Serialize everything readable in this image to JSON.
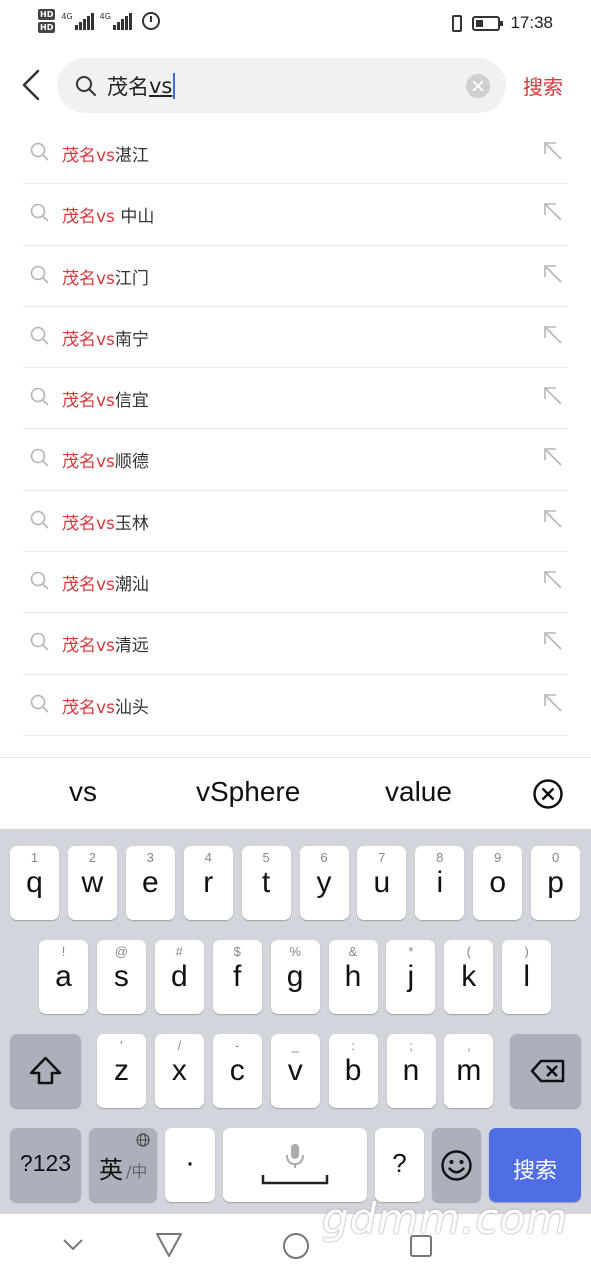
{
  "status_bar": {
    "sim1_label": "HD",
    "sim2_label": "HD",
    "net1_label": "4G",
    "net2_label": "4G",
    "time": "17:38",
    "battery_level": 0.35
  },
  "search": {
    "query_highlight": "茂名",
    "query_rest": "vs",
    "submit_label": "搜索"
  },
  "suggestions": [
    {
      "highlight": "茂名vs",
      "rest": "湛江"
    },
    {
      "highlight": "茂名vs",
      "rest": " 中山"
    },
    {
      "highlight": "茂名vs",
      "rest": "江门"
    },
    {
      "highlight": "茂名vs",
      "rest": "南宁"
    },
    {
      "highlight": "茂名vs",
      "rest": "信宜"
    },
    {
      "highlight": "茂名vs",
      "rest": "顺德"
    },
    {
      "highlight": "茂名vs",
      "rest": "玉林"
    },
    {
      "highlight": "茂名vs",
      "rest": "潮汕"
    },
    {
      "highlight": "茂名vs",
      "rest": "清远"
    },
    {
      "highlight": "茂名vs",
      "rest": "汕头"
    }
  ],
  "candidates": [
    "vs",
    "vSphere",
    "value"
  ],
  "keyboard": {
    "row1": [
      {
        "k": "q",
        "s": "1"
      },
      {
        "k": "w",
        "s": "2"
      },
      {
        "k": "e",
        "s": "3"
      },
      {
        "k": "r",
        "s": "4"
      },
      {
        "k": "t",
        "s": "5"
      },
      {
        "k": "y",
        "s": "6"
      },
      {
        "k": "u",
        "s": "7"
      },
      {
        "k": "i",
        "s": "8"
      },
      {
        "k": "o",
        "s": "9"
      },
      {
        "k": "p",
        "s": "0"
      }
    ],
    "row2": [
      {
        "k": "a",
        "s": "!"
      },
      {
        "k": "s",
        "s": "@"
      },
      {
        "k": "d",
        "s": "#"
      },
      {
        "k": "f",
        "s": "$"
      },
      {
        "k": "g",
        "s": "%"
      },
      {
        "k": "h",
        "s": "&"
      },
      {
        "k": "j",
        "s": "*"
      },
      {
        "k": "k",
        "s": "("
      },
      {
        "k": "l",
        "s": ")"
      }
    ],
    "row3": [
      {
        "k": "z",
        "s": "'"
      },
      {
        "k": "x",
        "s": "/"
      },
      {
        "k": "c",
        "s": "-"
      },
      {
        "k": "v",
        "s": "_"
      },
      {
        "k": "b",
        "s": ":"
      },
      {
        "k": "n",
        "s": ";"
      },
      {
        "k": "m",
        "s": ","
      }
    ],
    "sym_label": "?123",
    "lang_main": "英",
    "lang_sub": "/中",
    "dot_label": "·",
    "question_label": "?",
    "search_label": "搜索"
  },
  "watermark": "gdmm.com",
  "colors": {
    "accent_red": "#d6393b",
    "key_blue": "#4f6ee6",
    "keyboard_bg": "#d3d5dc"
  }
}
